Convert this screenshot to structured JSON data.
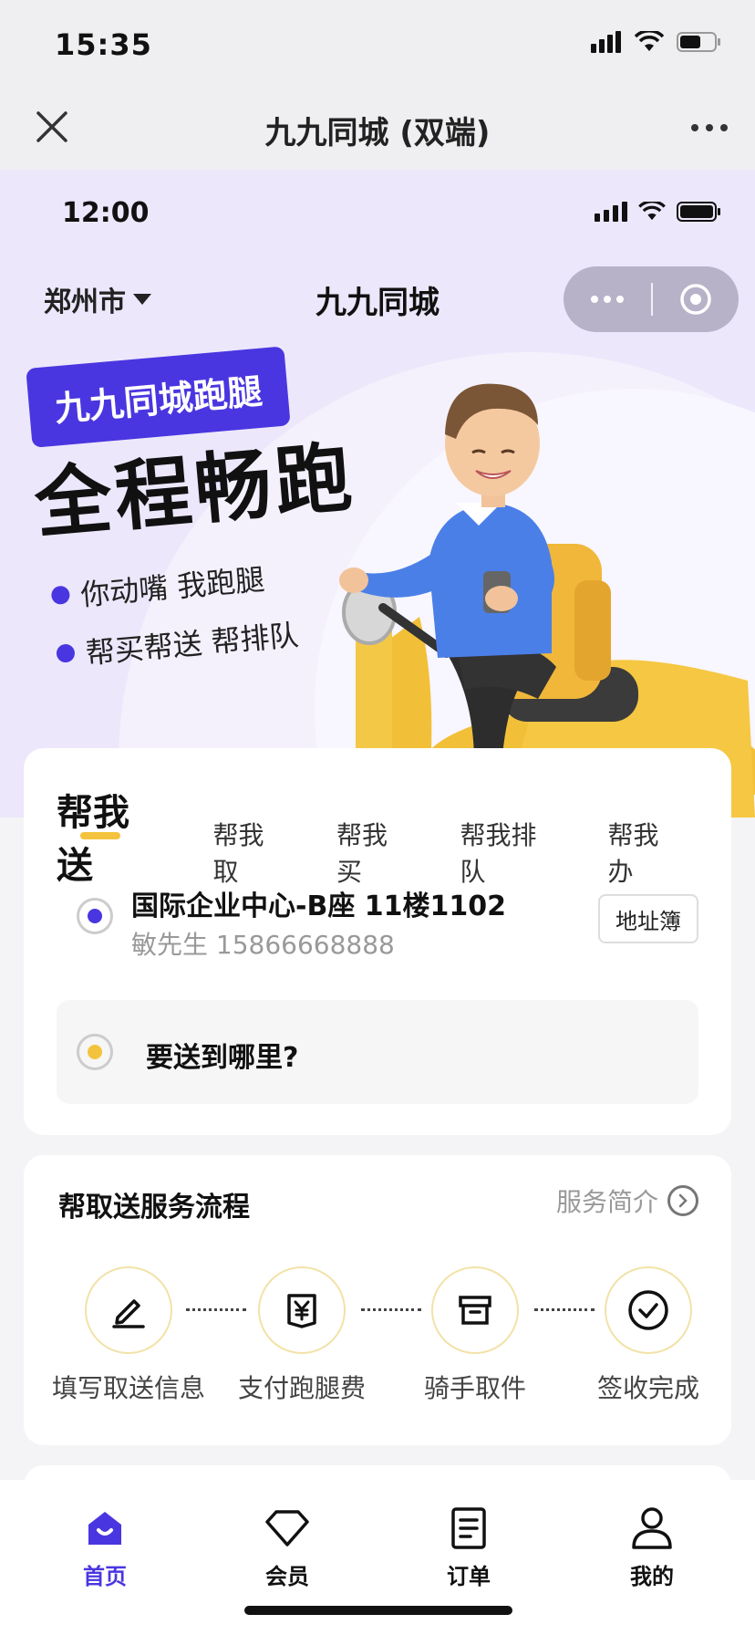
{
  "os_status": {
    "time": "15:35"
  },
  "host_bar": {
    "title": "九九同城 (双端)"
  },
  "mini_status": {
    "time": "12:00"
  },
  "header": {
    "city": "郑州市",
    "title": "九九同城"
  },
  "hero": {
    "tag": "九九同城跑腿",
    "headline": "全程畅跑",
    "bullets": [
      "你动嘴 我跑腿",
      "帮买帮送 帮排队"
    ]
  },
  "tabs": [
    {
      "label": "帮我送",
      "active": true
    },
    {
      "label": "帮我取",
      "active": false
    },
    {
      "label": "帮我买",
      "active": false
    },
    {
      "label": "帮我排队",
      "active": false
    },
    {
      "label": "帮我办",
      "active": false
    }
  ],
  "pickup": {
    "address": "国际企业中心-B座 11楼1102",
    "contact": "敏先生 15866668888",
    "address_book_label": "地址簿"
  },
  "destination": {
    "placeholder": "要送到哪里?"
  },
  "flow": {
    "title": "帮取送服务流程",
    "intro_label": "服务简介",
    "steps": [
      {
        "label": "填写取送信息",
        "icon": "pencil-icon"
      },
      {
        "label": "支付跑腿费",
        "icon": "yuan-receipt-icon"
      },
      {
        "label": "骑手取件",
        "icon": "archive-box-icon"
      },
      {
        "label": "签收完成",
        "icon": "check-circle-icon"
      }
    ]
  },
  "bottom_nav": [
    {
      "label": "首页",
      "icon": "home-icon",
      "active": true
    },
    {
      "label": "会员",
      "icon": "diamond-icon",
      "active": false
    },
    {
      "label": "订单",
      "icon": "document-icon",
      "active": false
    },
    {
      "label": "我的",
      "icon": "user-icon",
      "active": false
    }
  ],
  "colors": {
    "accent": "#4a36e0",
    "yellow": "#f4c33d",
    "hero_bg": "#ece7fb"
  }
}
